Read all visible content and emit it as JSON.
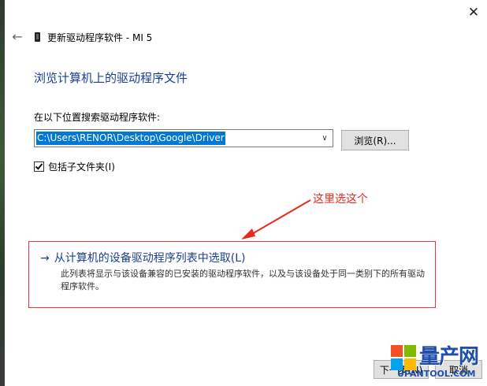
{
  "window": {
    "title": "更新驱动程序软件 - MI 5",
    "close_label": "✕",
    "back_label": "←"
  },
  "content": {
    "heading": "浏览计算机上的驱动程序文件",
    "search_label": "在以下位置搜索驱动程序软件:",
    "path_value": "C:\\Users\\RENOR\\Desktop\\Google\\Driver",
    "browse_label": "浏览(R)...",
    "include_subfolders_label": "包括子文件夹(I)",
    "include_subfolders_checked": true
  },
  "annotation": {
    "text": "这里选这个",
    "color": "#e8291c"
  },
  "pick_option": {
    "title": "从计算机的设备驱动程序列表中选取(L)",
    "description": "此列表将显示与该设备兼容的已安装的驱动程序软件，以及与该设备处于同一类别下的所有驱动程序软件。"
  },
  "footer": {
    "next_label": "下一步(N)",
    "cancel_label": "取消"
  },
  "watermark": {
    "name": "量产网",
    "url": "UPANTOOL.COM"
  },
  "colors": {
    "heading": "#1a3f8f",
    "selection": "#0078d7",
    "annotation": "#e8291c"
  }
}
